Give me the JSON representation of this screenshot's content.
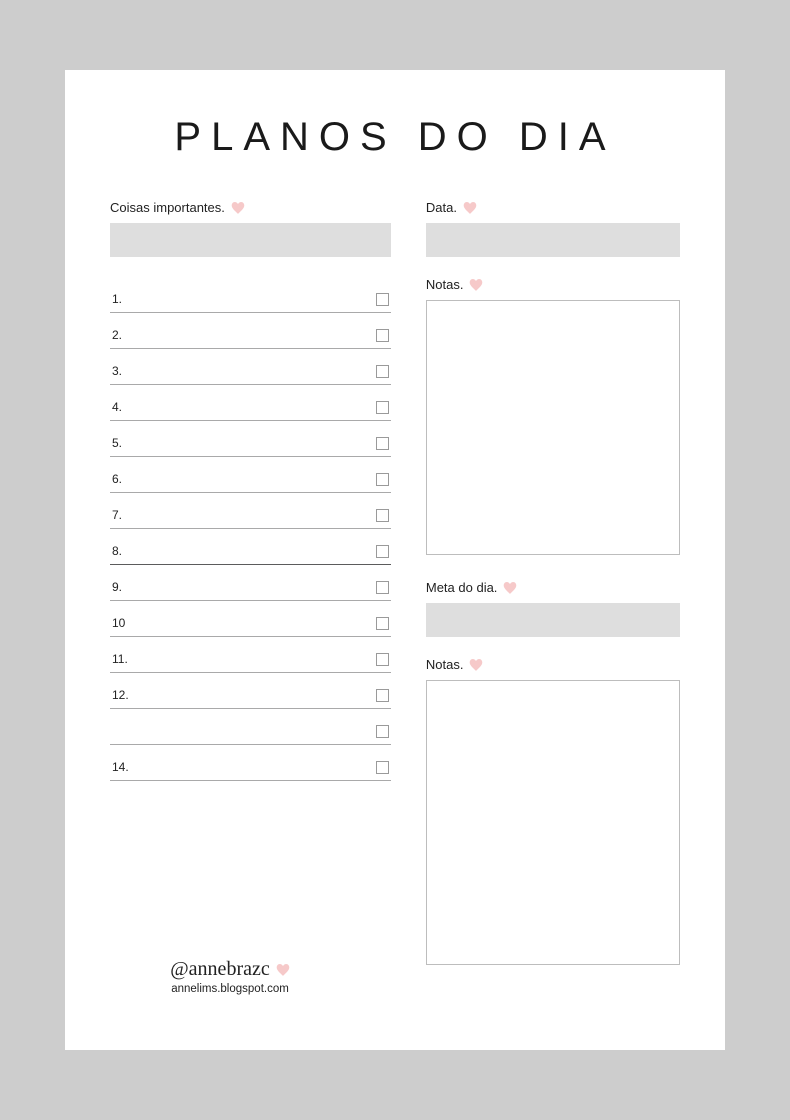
{
  "title": "PLANOS DO DIA",
  "left": {
    "important_label": "Coisas importantes.",
    "tasks": [
      "1.",
      "2.",
      "3.",
      "4.",
      "5.",
      "6.",
      "7.",
      "8.",
      "9.",
      "10",
      "11.",
      "12.",
      "",
      "14."
    ]
  },
  "right": {
    "date_label": "Data.",
    "notes1_label": "Notas.",
    "goal_label": "Meta do dia.",
    "notes2_label": "Notas."
  },
  "footer": {
    "handle": "@annebrazc",
    "url": "annelims.blogspot.com"
  }
}
